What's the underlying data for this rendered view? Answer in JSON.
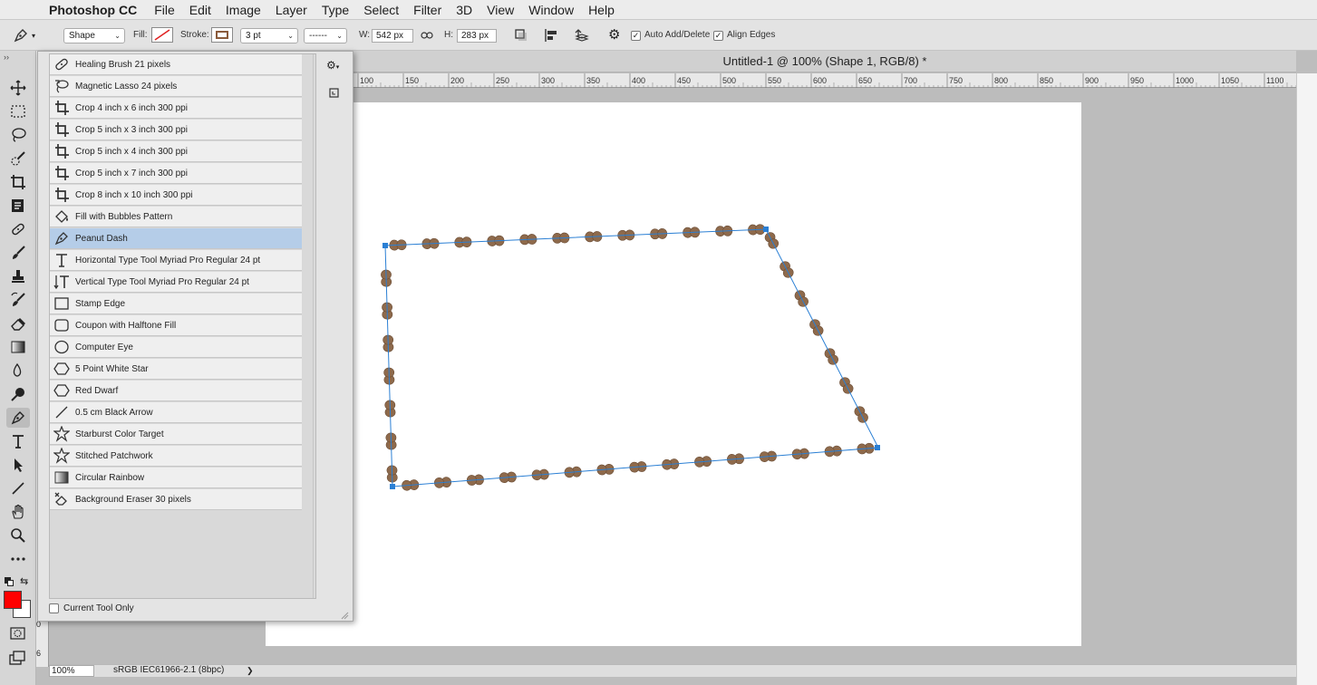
{
  "menubar": {
    "app": "Photoshop CC",
    "items": [
      "File",
      "Edit",
      "Image",
      "Layer",
      "Type",
      "Select",
      "Filter",
      "3D",
      "View",
      "Window",
      "Help"
    ]
  },
  "options": {
    "mode": "Shape",
    "fill_label": "Fill:",
    "stroke_label": "Stroke:",
    "stroke_width": "3 pt",
    "stroke_style": "------",
    "w_label": "W:",
    "w_value": "542 px",
    "h_label": "H:",
    "h_value": "283 px",
    "auto_add_delete": "Auto Add/Delete",
    "align_edges": "Align Edges",
    "stroke_color": "#8a5a3a",
    "fill_slash_color": "#e02020"
  },
  "document": {
    "title": "Untitled-1 @ 100% (Shape 1, RGB/8) *",
    "ruler_ticks": [
      "100",
      "150",
      "200",
      "250",
      "300",
      "350",
      "400",
      "450",
      "500",
      "550",
      "600",
      "650",
      "700",
      "750",
      "800",
      "850",
      "900",
      "950",
      "1000",
      "1050",
      "1100"
    ],
    "left_ruler_ticks": [
      "0",
      "6"
    ]
  },
  "status": {
    "zoom": "100%",
    "profile": "sRGB IEC61966-2.1 (8bpc)",
    "arrow": "❯"
  },
  "presets": {
    "items": [
      {
        "label": "Healing Brush 21 pixels",
        "icon": "healing-brush-icon"
      },
      {
        "label": "Magnetic Lasso 24 pixels",
        "icon": "magnetic-lasso-icon"
      },
      {
        "label": "Crop 4 inch x 6 inch 300 ppi",
        "icon": "crop-icon"
      },
      {
        "label": "Crop 5 inch x 3 inch 300 ppi",
        "icon": "crop-icon"
      },
      {
        "label": "Crop 5 inch x 4 inch 300 ppi",
        "icon": "crop-icon"
      },
      {
        "label": "Crop 5 inch x 7 inch 300 ppi",
        "icon": "crop-icon"
      },
      {
        "label": "Crop 8 inch x 10 inch 300 ppi",
        "icon": "crop-icon"
      },
      {
        "label": "Fill with Bubbles Pattern",
        "icon": "paint-bucket-icon"
      },
      {
        "label": "Peanut Dash",
        "icon": "pen-icon"
      },
      {
        "label": "Horizontal Type Tool Myriad Pro Regular 24 pt",
        "icon": "type-icon"
      },
      {
        "label": "Vertical Type Tool Myriad Pro Regular 24 pt",
        "icon": "vertical-type-icon"
      },
      {
        "label": "Stamp Edge",
        "icon": "rectangle-icon"
      },
      {
        "label": "Coupon with Halftone Fill",
        "icon": "rounded-rectangle-icon"
      },
      {
        "label": "Computer Eye",
        "icon": "ellipse-icon"
      },
      {
        "label": "5 Point White Star",
        "icon": "polygon-icon"
      },
      {
        "label": "Red Dwarf",
        "icon": "polygon-icon"
      },
      {
        "label": "0.5 cm Black Arrow",
        "icon": "line-icon"
      },
      {
        "label": "Starburst Color Target",
        "icon": "custom-shape-icon"
      },
      {
        "label": "Stitched Patchwork",
        "icon": "custom-shape-icon"
      },
      {
        "label": "Circular Rainbow",
        "icon": "gradient-icon"
      },
      {
        "label": "Background Eraser 30 pixels",
        "icon": "background-eraser-icon"
      }
    ],
    "selected_index": 8,
    "current_tool_only": "Current Tool Only"
  },
  "colors": {
    "foreground": "#ff0000",
    "background": "#ffffff",
    "path": "#2a7fd4",
    "peanut": "#8e6a4c",
    "selection": "#b5cde8"
  }
}
